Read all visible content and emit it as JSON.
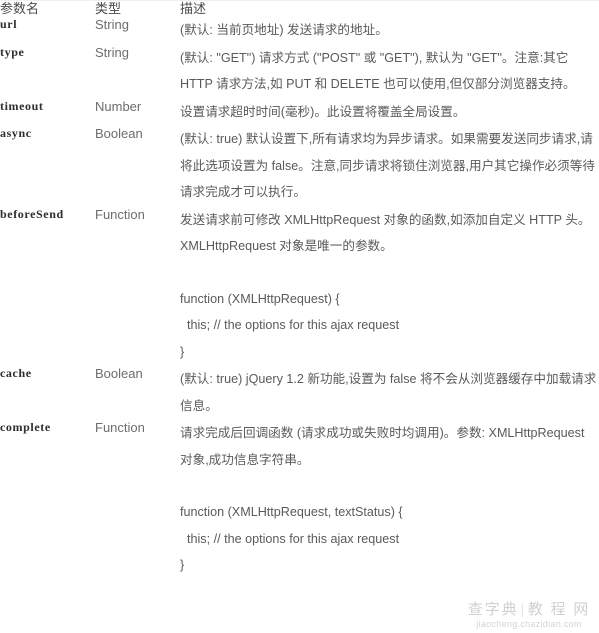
{
  "table": {
    "headers": {
      "param": "参数名",
      "type": "类型",
      "desc": "描述"
    },
    "rows": [
      {
        "param": "url",
        "type": "String",
        "desc_lines": [
          "(默认: 当前页地址) 发送请求的地址。"
        ],
        "code_lines": []
      },
      {
        "param": "type",
        "type": "String",
        "desc_lines": [
          "(默认: \"GET\") 请求方式 (\"POST\" 或 \"GET\"),  默认为 \"GET\"。注意:其它 HTTP 请求方法,如 PUT 和 DELETE 也可以使用,但仅部分浏览器支持。"
        ],
        "code_lines": []
      },
      {
        "param": "timeout",
        "type": "Number",
        "desc_lines": [
          "设置请求超时时间(毫秒)。此设置将覆盖全局设置。"
        ],
        "code_lines": []
      },
      {
        "param": "async",
        "type": "Boolean",
        "desc_lines": [
          "(默认: true) 默认设置下,所有请求均为异步请求。如果需要发送同步请求,请将此选项设置为 false。注意,同步请求将锁住浏览器,用户其它操作必须等待请求完成才可以执行。"
        ],
        "code_lines": []
      },
      {
        "param": "beforeSend",
        "type": "Function",
        "desc_lines": [
          "发送请求前可修改 XMLHttpRequest 对象的函数,如添加自定义 HTTP 头。XMLHttpRequest 对象是唯一的参数。"
        ],
        "code_lines": [
          "function (XMLHttpRequest) {",
          "  this; // the options for this ajax request",
          "}"
        ]
      },
      {
        "param": "cache",
        "type": "Boolean",
        "desc_lines": [
          "(默认: true) jQuery 1.2 新功能,设置为 false 将不会从浏览器缓存中加载请求信息。"
        ],
        "code_lines": []
      },
      {
        "param": "complete",
        "type": "Function",
        "desc_lines": [
          "请求完成后回调函数 (请求成功或失败时均调用)。参数: XMLHttpRequest 对象,成功信息字符串。"
        ],
        "code_lines": [
          "function (XMLHttpRequest, textStatus) {",
          "  this; // the options for this ajax request",
          "}"
        ]
      }
    ]
  },
  "watermark": {
    "brand": "查字典",
    "separator": "|",
    "section": "教 程 网",
    "url": "jiaocheng.chazidian.com"
  }
}
